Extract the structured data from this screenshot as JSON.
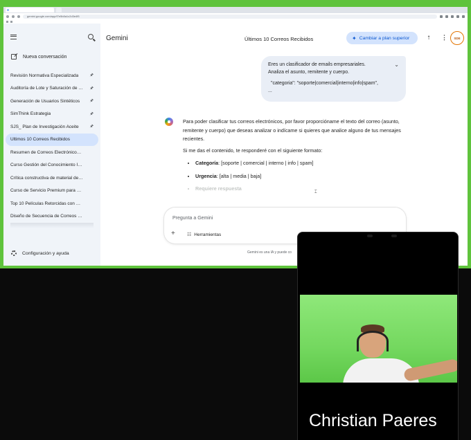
{
  "browser": {
    "url": "gemini.google.com/app/f7e5b8a1c2d3e4f5"
  },
  "sidebar": {
    "new_chat": "Nueva conversación",
    "items": [
      {
        "label": "Revisión Normativa Especializada",
        "pinned": true,
        "active": false
      },
      {
        "label": "Auditoría de Lote y Saturación de Carga",
        "pinned": true,
        "active": false
      },
      {
        "label": "Generación de Usuarios Sintéticos",
        "pinned": true,
        "active": false
      },
      {
        "label": "SimThink Estrategia",
        "pinned": true,
        "active": false
      },
      {
        "label": "SJS_ Plan de Investigación Aceite",
        "pinned": true,
        "active": false
      },
      {
        "label": "Últimos 10 Correos Recibidos",
        "pinned": false,
        "active": true
      },
      {
        "label": "Resumen de Correos Electrónicos Recientes",
        "pinned": false,
        "active": false
      },
      {
        "label": "Curso Gestión del Conocimiento IUSH",
        "pinned": false,
        "active": false
      },
      {
        "label": "Crítica constructiva de material de curso",
        "pinned": false,
        "active": false
      },
      {
        "label": "Curso de Servicio Premium para Peluquerías",
        "pinned": false,
        "active": false
      },
      {
        "label": "Top 10 Películas Retorcidas con Giros",
        "pinned": false,
        "active": false
      },
      {
        "label": "Diseño de Secuencia de Correos Comerciales",
        "pinned": false,
        "active": false
      }
    ],
    "settings": "Configuración y ayuda"
  },
  "header": {
    "brand": "Gemini",
    "title": "Últimos 10 Correos Recibidos",
    "upgrade": "Cambiar a plan superior",
    "avatar_text": "SDE"
  },
  "user_message": {
    "line1": "Eres un clasificador de emails empresariales.",
    "line2": "Analiza el asunto, remitente y cuerpo.",
    "line3": "\"categoria\": \"soporte|comercial|interno|info|spam\",",
    "line4": "..."
  },
  "response": {
    "p1": "Para poder clasificar tus correos electrónicos, por favor proporcióname el texto del correo (asunto, remitente y cuerpo) que deseas analizar o indícame si quieres que analice alguno de tus mensajes recientes.",
    "p2": "Si me das el contenido, te responderé con el siguiente formato:",
    "items": [
      {
        "key": "Categoría",
        "value": ": [soporte | comercial | interno | info | spam]"
      },
      {
        "key": "Urgencia",
        "value": ": [alta | media | baja]"
      },
      {
        "key": "",
        "value": "Requiere respuesta"
      }
    ]
  },
  "input": {
    "placeholder": "Pregunta a Gemini",
    "tools": "Herramientas"
  },
  "disclaimer": "Gemini es una IA y puede co",
  "webcam": {
    "name": "Christian Paeres"
  },
  "colors": {
    "share_border": "#5fc33c",
    "upgrade_bg": "#d3e3fd",
    "upgrade_text": "#0b57d0",
    "sidebar_bg": "#f0f4f9"
  }
}
